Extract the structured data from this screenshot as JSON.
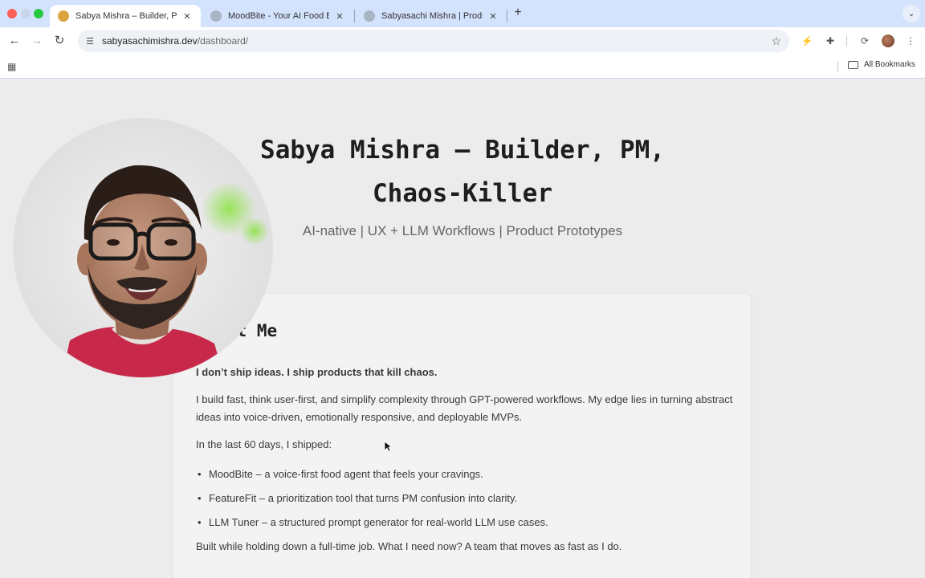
{
  "browser": {
    "tabs": [
      {
        "title": "Sabya Mishra – Builder, PM, C",
        "active": true,
        "favicon_color": "#d9a441"
      },
      {
        "title": "MoodBite - Your AI Food Bud",
        "active": false,
        "favicon_color": "#a8b3c4"
      },
      {
        "title": "Sabyasachi Mishra | Product",
        "active": false,
        "favicon_color": "#a8b3c4"
      }
    ],
    "new_tab": "+",
    "tab_menu": "⌄",
    "url_domain": "sabyasachimishra.dev",
    "url_path": "/dashboard/",
    "all_bookmarks": "All Bookmarks"
  },
  "hero": {
    "title_line1": "Sabya Mishra – Builder, PM,",
    "title_line2": "Chaos-Killer",
    "subtitle": "AI-native | UX + LLM Workflows | Product Prototypes"
  },
  "about": {
    "heading": "About Me",
    "tagline": "I don’t ship ideas. I ship products that kill chaos.",
    "intro": "I build fast, think user-first, and simplify complexity through GPT-powered workflows. My edge lies in turning abstract ideas into voice-driven, emotionally responsive, and deployable MVPs.",
    "shipped_intro": "In the last 60 days, I shipped:",
    "shipped": [
      "MoodBite – a voice-first food agent that feels your cravings.",
      "FeatureFit – a prioritization tool that turns PM confusion into clarity.",
      "LLM Tuner – a structured prompt generator for real-world LLM use cases."
    ],
    "closing": "Built while holding down a full-time job. What I need now? A team that moves as fast as I do."
  },
  "colors": {
    "tabbar": "#d3e3fd",
    "page_bg": "#ececec",
    "card_bg": "#f3f3f3",
    "shirt": "#c8284a"
  }
}
